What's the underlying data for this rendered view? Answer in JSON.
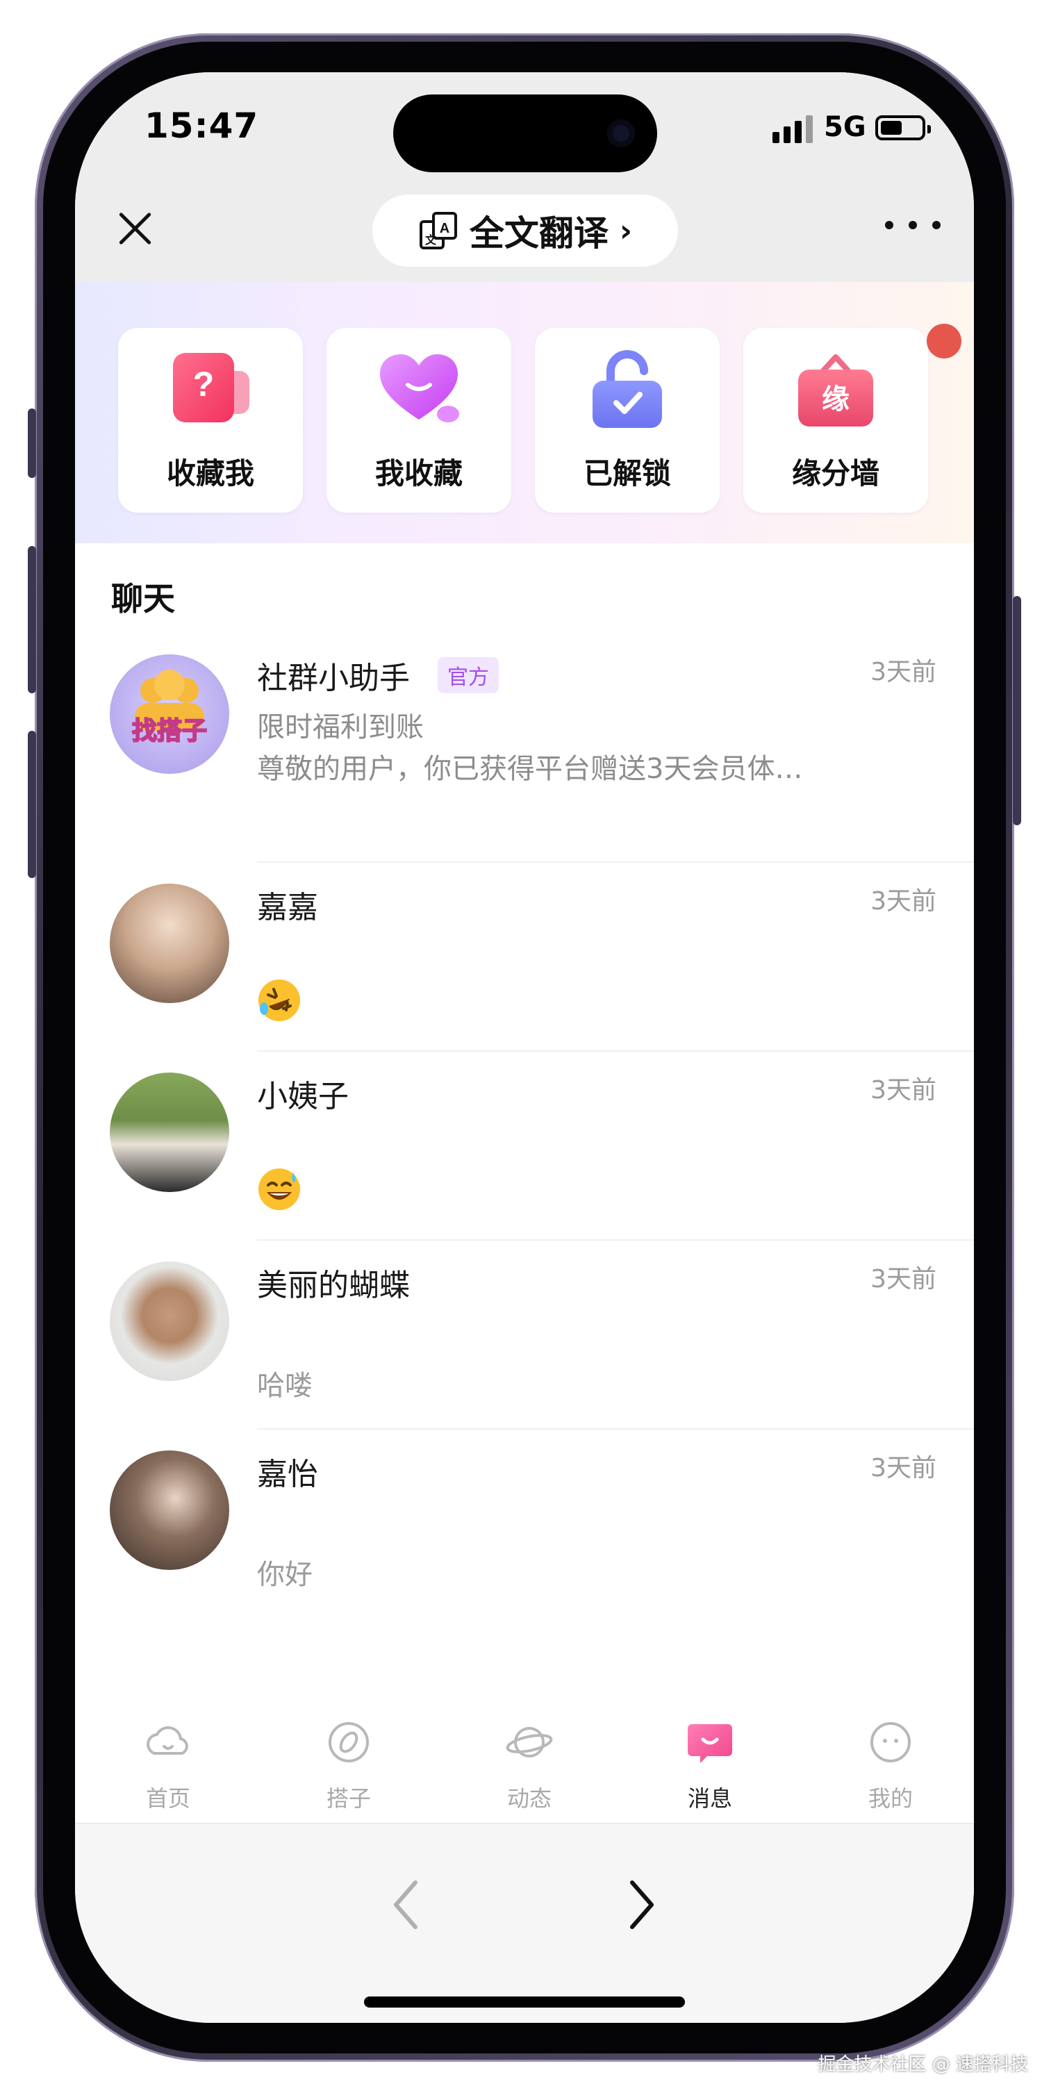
{
  "status_bar": {
    "time": "15:47",
    "network": "5G"
  },
  "nav": {
    "translate_label": "全文翻译"
  },
  "quick_cards": [
    {
      "label": "收藏我",
      "icon": "question-bubble-icon"
    },
    {
      "label": "我收藏",
      "icon": "heart-smile-icon"
    },
    {
      "label": "已解锁",
      "icon": "unlocked-padlock-icon"
    },
    {
      "label": "缘分墙",
      "icon": "fate-bag-icon",
      "glyph": "缘"
    }
  ],
  "chat_section_title": "聊天",
  "chats": [
    {
      "name": "社群小助手",
      "badge": "官方",
      "time": "3天前",
      "line1": "限时福利到账",
      "line2": "尊敬的用户，你已获得平台赠送3天会员体…",
      "avatar_text": "找搭子"
    },
    {
      "name": "嘉嘉",
      "time": "3天前",
      "message_emoji": "rolling-laughing-emoji"
    },
    {
      "name": "小姨子",
      "time": "3天前",
      "message_emoji": "sweat-smile-emoji"
    },
    {
      "name": "美丽的蝴蝶",
      "time": "3天前",
      "message": "哈喽"
    },
    {
      "name": "嘉怡",
      "time": "3天前",
      "message": "你好"
    }
  ],
  "tabs": [
    {
      "label": "首页",
      "active": false
    },
    {
      "label": "搭子",
      "active": false
    },
    {
      "label": "动态",
      "active": false
    },
    {
      "label": "消息",
      "active": true
    },
    {
      "label": "我的",
      "active": false
    }
  ],
  "watermark": "掘金技术社区 @ 速搭科技",
  "colors": {
    "accent": "#ff5fa0",
    "badge": "#a04ef0",
    "notification_dot": "#e5574d"
  }
}
